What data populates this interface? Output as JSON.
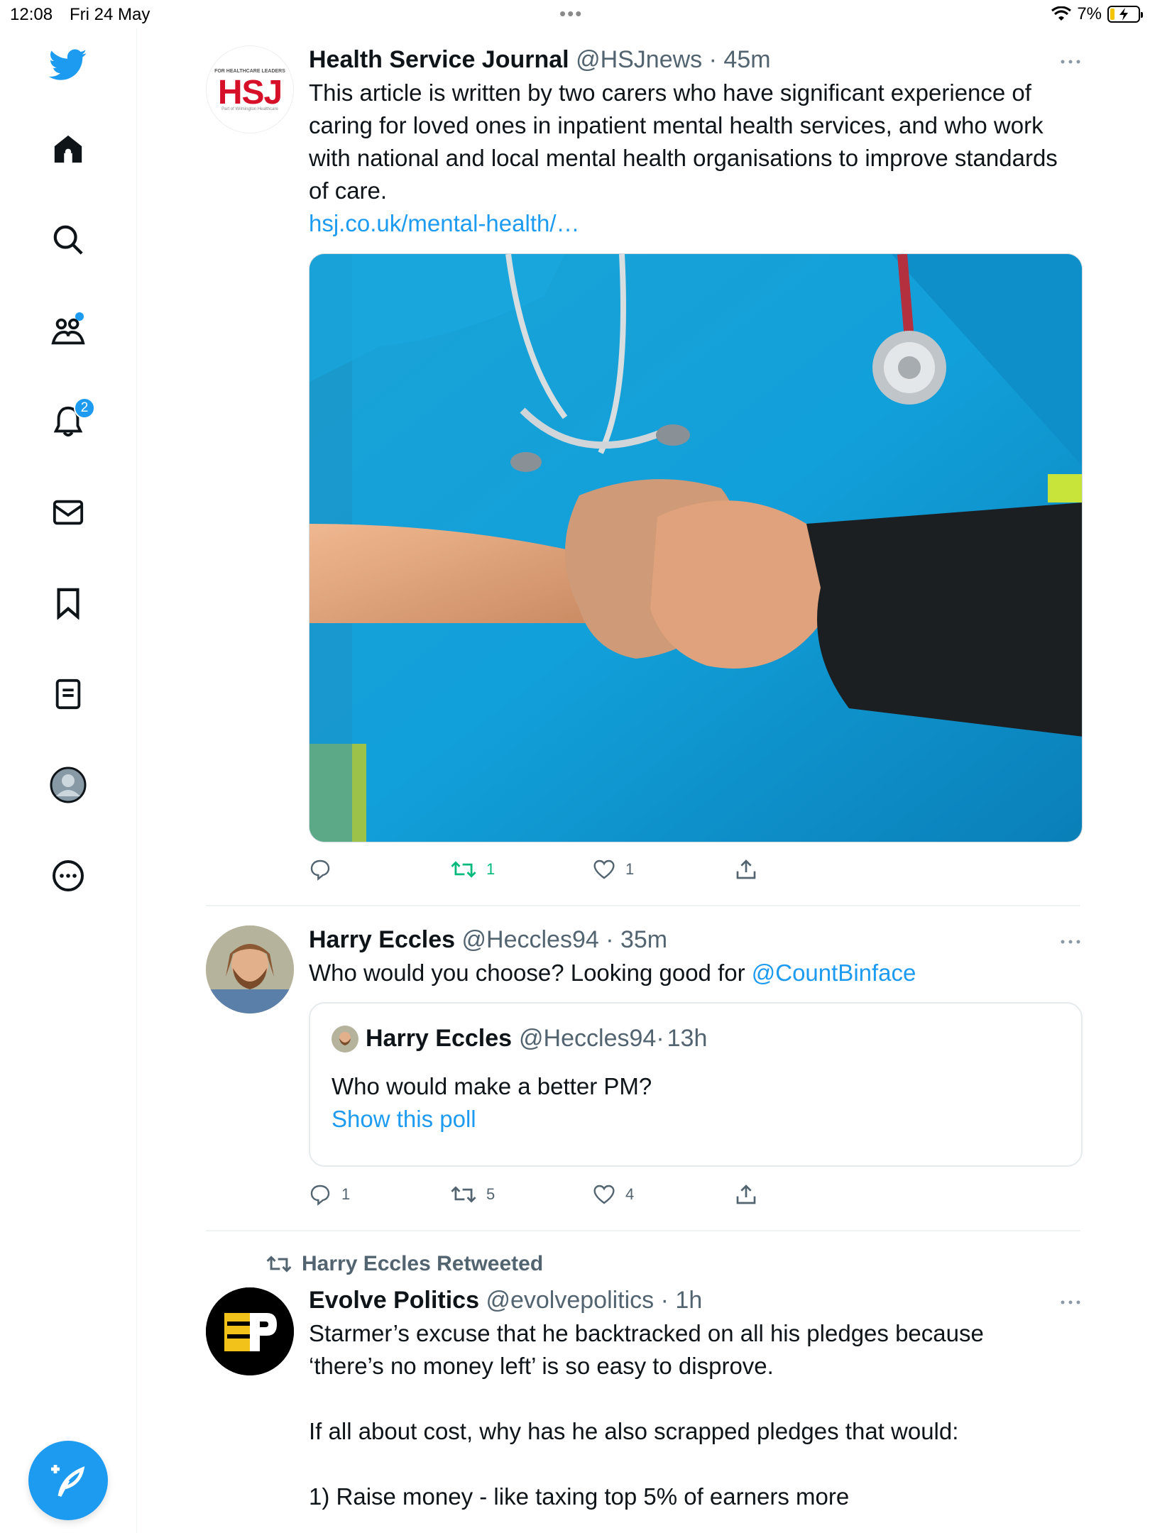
{
  "status_bar": {
    "time": "12:08",
    "date": "Fri 24 May",
    "battery": "7%"
  },
  "sidebar": {
    "notifications_badge": "2"
  },
  "tweets": [
    {
      "name": "Health Service Journal",
      "handle": "@HSJnews",
      "time": "45m",
      "text": "This article is written by two carers who have significant experience of caring for loved ones in inpatient mental health services, and who work with national and local mental health organisations to improve standards of care.",
      "link": "hsj.co.uk/mental-health/…",
      "avatar_logo": {
        "tagline": "FOR HEALTHCARE LEADERS",
        "mark": "HSJ",
        "sub": "Part of Wilmington Healthcare"
      },
      "counts": {
        "reply": "",
        "retweet": "1",
        "like": "1"
      }
    },
    {
      "name": "Harry Eccles",
      "handle": "@Heccles94",
      "time": "35m",
      "text": "Who would you choose? Looking good for ",
      "mention": "@CountBinface",
      "quote": {
        "name": "Harry Eccles",
        "handle": "@Heccles94",
        "time": "13h",
        "text": "Who would make a better PM?",
        "link": "Show this poll"
      },
      "counts": {
        "reply": "1",
        "retweet": "5",
        "like": "4"
      }
    },
    {
      "retweeted_by": "Harry Eccles Retweeted",
      "name": "Evolve Politics",
      "handle": "@evolvepolitics",
      "time": "1h",
      "paragraphs": [
        "Starmer’s excuse that he backtracked on all his pledges because ‘there’s no money left’ is so easy to disprove.",
        "If all about cost, why has he also scrapped pledges that would:",
        "1) Raise money - like taxing top 5% of earners more"
      ]
    }
  ],
  "colors": {
    "accent": "#1d9bf0",
    "retweet": "#00ba7c",
    "muted": "#536471"
  }
}
